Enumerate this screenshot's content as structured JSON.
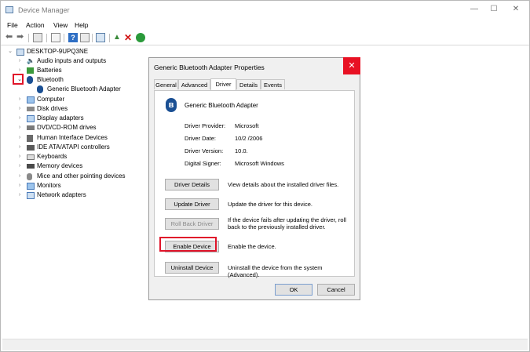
{
  "window": {
    "title": "Device Manager",
    "controls": {
      "minimize": "—",
      "maximize": "☐",
      "close": "✕"
    }
  },
  "menu": [
    "File",
    "Action",
    "View",
    "Help"
  ],
  "tree": {
    "root": "DESKTOP-9UPQ3NE",
    "nodes": [
      {
        "label": "Audio inputs and outputs",
        "icon": "speaker-icon",
        "expanded": false
      },
      {
        "label": "Batteries",
        "icon": "battery-icon",
        "expanded": false
      },
      {
        "label": "Bluetooth",
        "icon": "bluetooth-icon",
        "expanded": true,
        "children": [
          {
            "label": "Generic Bluetooth Adapter",
            "icon": "bluetooth-icon"
          }
        ]
      },
      {
        "label": "Computer",
        "icon": "computer-icon",
        "expanded": false
      },
      {
        "label": "Disk drives",
        "icon": "disk-icon",
        "expanded": false
      },
      {
        "label": "Display adapters",
        "icon": "display-icon",
        "expanded": false
      },
      {
        "label": "DVD/CD-ROM drives",
        "icon": "dvd-icon",
        "expanded": false
      },
      {
        "label": "Human Interface Devices",
        "icon": "hid-icon",
        "expanded": false
      },
      {
        "label": "IDE ATA/ATAPI controllers",
        "icon": "ide-icon",
        "expanded": false
      },
      {
        "label": "Keyboards",
        "icon": "keyboard-icon",
        "expanded": false
      },
      {
        "label": "Memory devices",
        "icon": "memory-icon",
        "expanded": false
      },
      {
        "label": "Mice and other pointing devices",
        "icon": "mouse-icon",
        "expanded": false
      },
      {
        "label": "Monitors",
        "icon": "monitor-icon",
        "expanded": false
      },
      {
        "label": "Network adapters",
        "icon": "network-icon",
        "expanded": false
      }
    ]
  },
  "dialog": {
    "title": "Generic Bluetooth Adapter Properties",
    "close": "✕",
    "tabs": [
      "General",
      "Advanced",
      "Driver",
      "Details",
      "Events"
    ],
    "active_tab": "Driver",
    "device_name": "Generic Bluetooth Adapter",
    "properties": [
      {
        "key": "Driver Provider:",
        "value": "Microsoft"
      },
      {
        "key": "Driver Date:",
        "value": "10/2 /2006"
      },
      {
        "key": "Driver Version:",
        "value": "10.0."
      },
      {
        "key": "Digital Signer:",
        "value": "Microsoft Windows"
      }
    ],
    "actions": [
      {
        "label": "Driver Details",
        "desc": "View details about the installed driver files.",
        "enabled": true
      },
      {
        "label": "Update Driver",
        "desc": "Update the driver for this device.",
        "enabled": true
      },
      {
        "label": "Roll Back Driver",
        "desc": "If the device fails after updating the driver, roll back to the previously installed driver.",
        "enabled": false
      },
      {
        "label": "Enable Device",
        "desc": "Enable the device.",
        "enabled": true,
        "highlighted": true
      },
      {
        "label": "Uninstall Device",
        "desc": "Uninstall the device from the system (Advanced).",
        "enabled": true
      }
    ],
    "ok": "OK",
    "cancel": "Cancel"
  },
  "colors": {
    "highlight": "#e0142a",
    "close_red": "#e81123",
    "bluetooth_blue": "#1a4f93"
  }
}
